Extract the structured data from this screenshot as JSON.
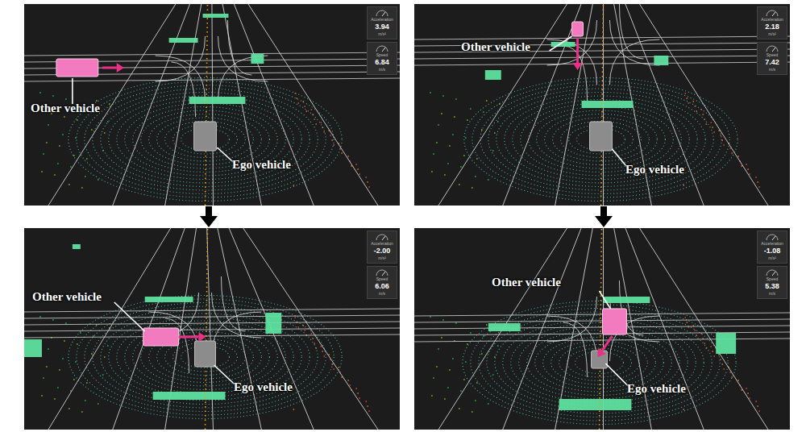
{
  "panels": [
    {
      "other_label": "Other vehicle",
      "ego_label": "Ego vehicle",
      "gauges": [
        {
          "label": "Acceleration",
          "reading": "3.94",
          "unit": "m/s²"
        },
        {
          "label": "Speed",
          "reading": "6.84",
          "unit": "m/s"
        }
      ]
    },
    {
      "other_label": "Other vehicle",
      "ego_label": "Ego vehicle",
      "gauges": [
        {
          "label": "Acceleration",
          "reading": "2.18",
          "unit": "m/s²"
        },
        {
          "label": "Speed",
          "reading": "7.42",
          "unit": "m/s"
        }
      ]
    },
    {
      "other_label": "Other vehicle",
      "ego_label": "Ego vehicle",
      "gauges": [
        {
          "label": "Acceleration",
          "reading": "-2.00",
          "unit": "m/s²"
        },
        {
          "label": "Speed",
          "reading": "6.06",
          "unit": "m/s"
        }
      ]
    },
    {
      "other_label": "Other vehicle",
      "ego_label": "Ego vehicle",
      "gauges": [
        {
          "label": "Acceleration",
          "reading": "-1.08",
          "unit": "m/s²"
        },
        {
          "label": "Speed",
          "reading": "5.38",
          "unit": "m/s"
        }
      ]
    }
  ]
}
